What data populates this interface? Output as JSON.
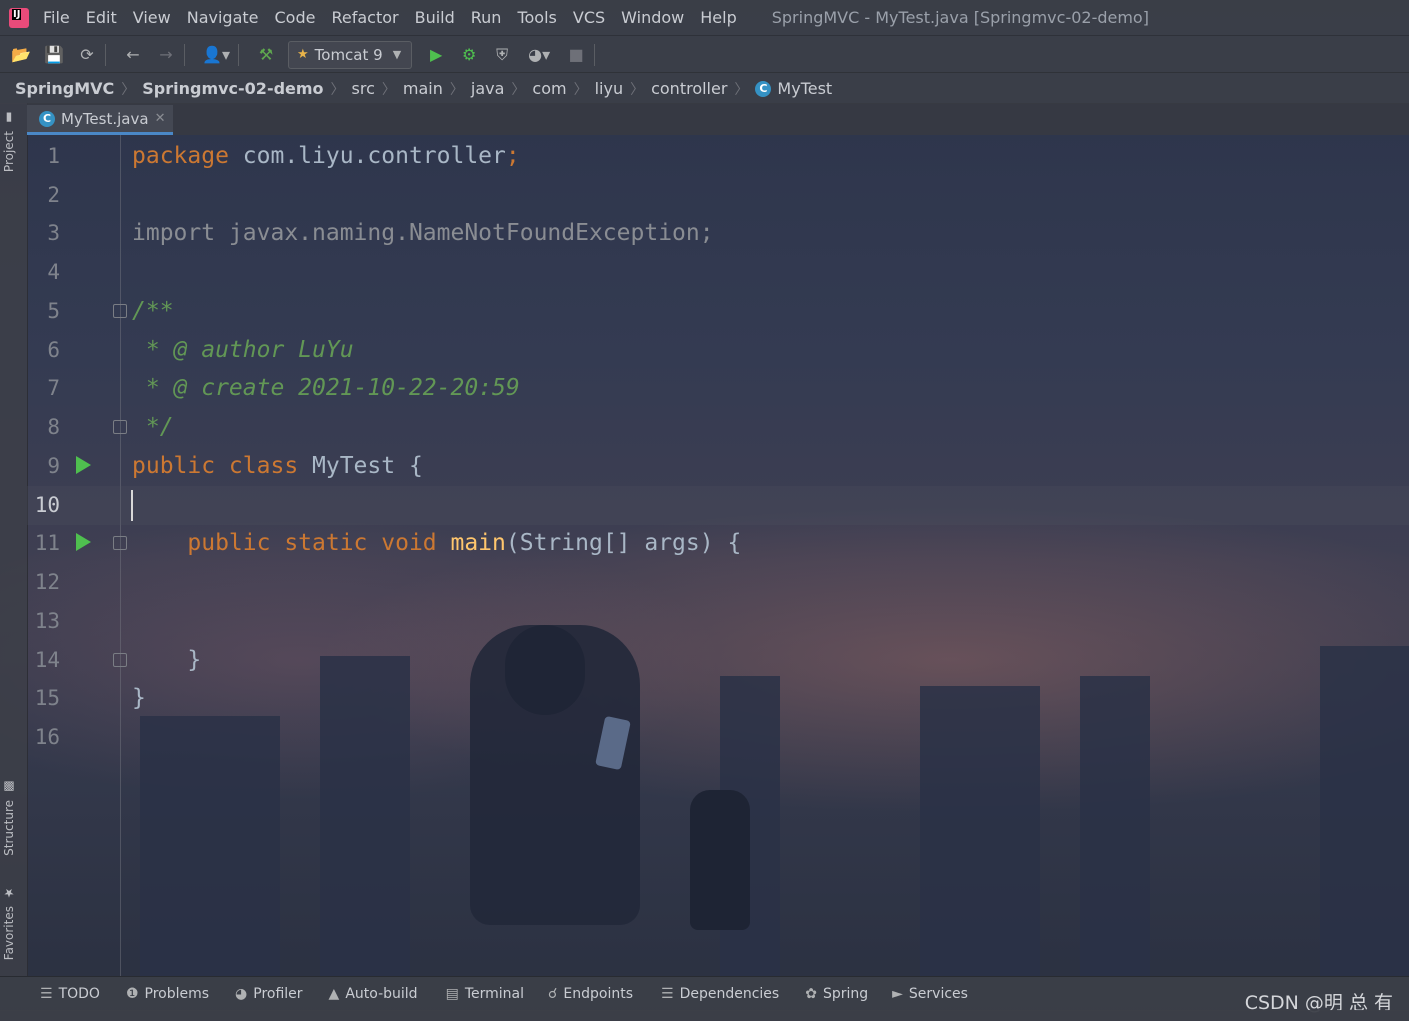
{
  "menubar": {
    "items": [
      "File",
      "Edit",
      "View",
      "Navigate",
      "Code",
      "Refactor",
      "Build",
      "Run",
      "Tools",
      "VCS",
      "Window",
      "Help"
    ],
    "title": "SpringMVC - MyTest.java [Springmvc-02-demo]"
  },
  "toolbar": {
    "run_config": "Tomcat 9"
  },
  "breadcrumb": [
    "SpringMVC",
    "Springmvc-02-demo",
    "src",
    "main",
    "java",
    "com",
    "liyu",
    "controller",
    "MyTest"
  ],
  "left_tools": [
    "Project",
    "Structure",
    "Favorites"
  ],
  "editor_tab": {
    "label": "MyTest.java"
  },
  "code_lines": [
    {
      "n": "1"
    },
    {
      "n": "2"
    },
    {
      "n": "3"
    },
    {
      "n": "4"
    },
    {
      "n": "5"
    },
    {
      "n": "6"
    },
    {
      "n": "7"
    },
    {
      "n": "8"
    },
    {
      "n": "9"
    },
    {
      "n": "10"
    },
    {
      "n": "11"
    },
    {
      "n": "12"
    },
    {
      "n": "13"
    },
    {
      "n": "14"
    },
    {
      "n": "15"
    },
    {
      "n": "16"
    }
  ],
  "code": {
    "l1_kw": "package",
    "l1_id": " com.liyu.controller",
    "l1_semi": ";",
    "l3": "import javax.naming.NameNotFoundException;",
    "l5": "/**",
    "l6": " * @ author LuYu",
    "l7": " * @ create 2021-10-22-20:59",
    "l8": " */",
    "l9_kw": "public class",
    "l9_id": " MyTest {",
    "l11_indent": "    ",
    "l11_kw": "public static void",
    "l11_fn": " main",
    "l11_rest": "(String[] args) {",
    "l14": "    }",
    "l15": "}"
  },
  "bottom_tools": [
    "TODO",
    "Problems",
    "Profiler",
    "Auto-build",
    "Terminal",
    "Endpoints",
    "Dependencies",
    "Spring",
    "Services"
  ],
  "watermark": "CSDN @明 总 有",
  "colors": {
    "keyword": "#cc7832",
    "doc_comment": "#629755",
    "function": "#ffc66d",
    "identifier": "#a9b7c6",
    "run_gutter": "#4fbf4f",
    "tab_accent": "#4a88c7"
  }
}
